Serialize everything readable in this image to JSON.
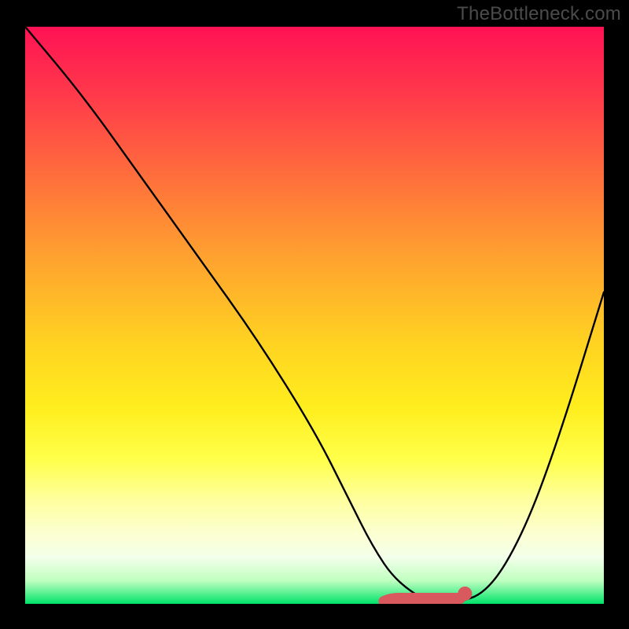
{
  "watermark": "TheBottleneck.com",
  "colors": {
    "background": "#000000",
    "watermark_text": "#4b4b4b",
    "curve": "#000000",
    "marker": "#d85a5e"
  },
  "chart_data": {
    "type": "line",
    "title": "",
    "xlabel": "",
    "ylabel": "",
    "xlim": [
      0,
      100
    ],
    "ylim": [
      0,
      100
    ],
    "x": [
      0,
      10,
      20,
      30,
      40,
      50,
      56,
      60,
      64,
      70,
      74,
      80,
      86,
      92,
      100
    ],
    "values": [
      100,
      88,
      74,
      60,
      46,
      30,
      18,
      10,
      4,
      0,
      0,
      2,
      12,
      28,
      54
    ],
    "annotation": {
      "note": "red marker segment near curve minimum",
      "x_range": [
        62,
        76
      ],
      "y": 0,
      "dot_x": 76
    },
    "background_gradient_stops": [
      {
        "pos": 0,
        "color": "#ff1254"
      },
      {
        "pos": 12,
        "color": "#ff3a4a"
      },
      {
        "pos": 25,
        "color": "#ff6b3d"
      },
      {
        "pos": 40,
        "color": "#ffa22f"
      },
      {
        "pos": 55,
        "color": "#ffd321"
      },
      {
        "pos": 66,
        "color": "#ffee1e"
      },
      {
        "pos": 75,
        "color": "#ffff4a"
      },
      {
        "pos": 82,
        "color": "#feff9e"
      },
      {
        "pos": 88,
        "color": "#fcffd2"
      },
      {
        "pos": 92,
        "color": "#f2ffea"
      },
      {
        "pos": 96,
        "color": "#bfffbf"
      },
      {
        "pos": 100,
        "color": "#00e36b"
      }
    ]
  }
}
